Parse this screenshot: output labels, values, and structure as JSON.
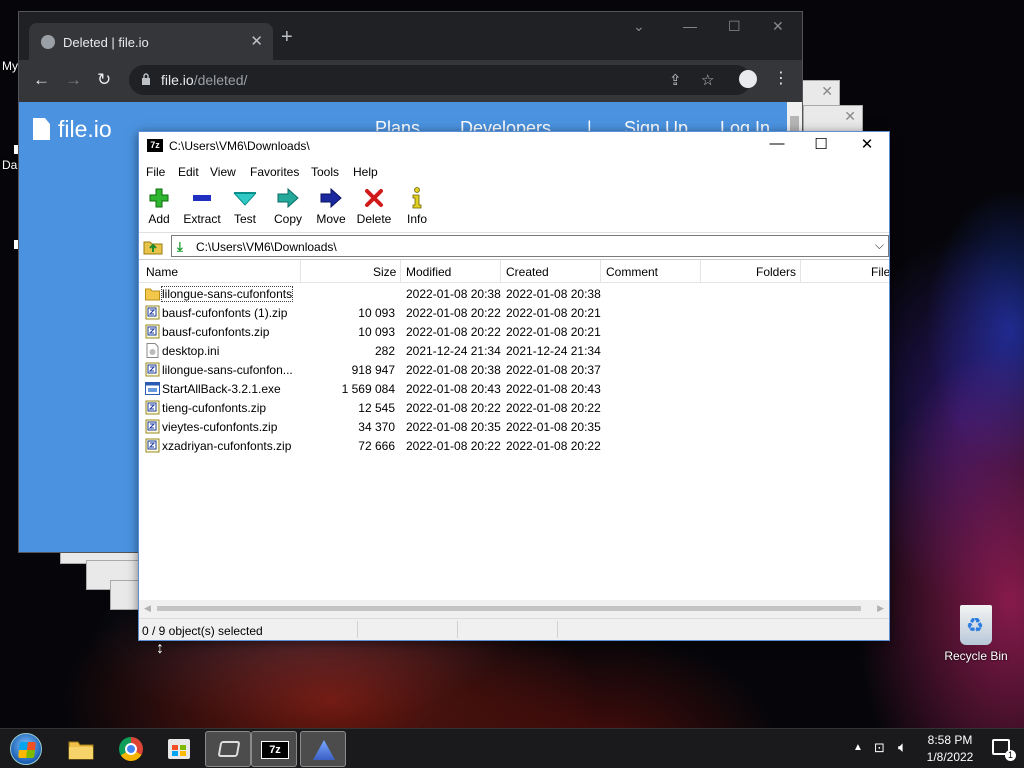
{
  "desktop": {
    "labels": [
      "My",
      "Da"
    ],
    "recycle_bin_label": "Recycle Bin"
  },
  "browser": {
    "tab_title": "Deleted | file.io",
    "url_host": "file.io",
    "url_path": "/deleted/",
    "site": {
      "logo_text": "file.io",
      "nav": [
        "Plans",
        "Developers",
        "|",
        "Sign Up",
        "Log In"
      ]
    }
  },
  "sevenzip": {
    "title": "C:\\Users\\VM6\\Downloads\\",
    "app_icon_text": "7z",
    "menu": [
      "File",
      "Edit",
      "View",
      "Favorites",
      "Tools",
      "Help"
    ],
    "toolbar": [
      {
        "label": "Add",
        "icon": "add-icon"
      },
      {
        "label": "Extract",
        "icon": "extract-icon"
      },
      {
        "label": "Test",
        "icon": "test-icon"
      },
      {
        "label": "Copy",
        "icon": "copy-icon"
      },
      {
        "label": "Move",
        "icon": "move-icon"
      },
      {
        "label": "Delete",
        "icon": "delete-icon"
      },
      {
        "label": "Info",
        "icon": "info-icon"
      }
    ],
    "address": "C:\\Users\\VM6\\Downloads\\",
    "columns": [
      "Name",
      "Size",
      "Modified",
      "Created",
      "Comment",
      "Folders",
      "File"
    ],
    "rows": [
      {
        "name": "lilongue-sans-cufonfonts",
        "size": "",
        "modified": "2022-01-08 20:38",
        "created": "2022-01-08 20:38",
        "type": "folder"
      },
      {
        "name": "bausf-cufonfonts (1).zip",
        "size": "10 093",
        "modified": "2022-01-08 20:22",
        "created": "2022-01-08 20:21",
        "type": "zip"
      },
      {
        "name": "bausf-cufonfonts.zip",
        "size": "10 093",
        "modified": "2022-01-08 20:22",
        "created": "2022-01-08 20:21",
        "type": "zip"
      },
      {
        "name": "desktop.ini",
        "size": "282",
        "modified": "2021-12-24 21:34",
        "created": "2021-12-24 21:34",
        "type": "ini"
      },
      {
        "name": "lilongue-sans-cufonfon...",
        "size": "918 947",
        "modified": "2022-01-08 20:38",
        "created": "2022-01-08 20:37",
        "type": "zip"
      },
      {
        "name": "StartAllBack-3.2.1.exe",
        "size": "1 569 084",
        "modified": "2022-01-08 20:43",
        "created": "2022-01-08 20:43",
        "type": "exe"
      },
      {
        "name": "tieng-cufonfonts.zip",
        "size": "12 545",
        "modified": "2022-01-08 20:22",
        "created": "2022-01-08 20:22",
        "type": "zip"
      },
      {
        "name": "vieytes-cufonfonts.zip",
        "size": "34 370",
        "modified": "2022-01-08 20:35",
        "created": "2022-01-08 20:35",
        "type": "zip"
      },
      {
        "name": "xzadriyan-cufonfonts.zip",
        "size": "72 666",
        "modified": "2022-01-08 20:22",
        "created": "2022-01-08 20:22",
        "type": "zip"
      }
    ],
    "status": "0 / 9 object(s) selected"
  },
  "taskbar": {
    "time": "8:58 PM",
    "date": "1/8/2022",
    "notification_count": "1"
  }
}
